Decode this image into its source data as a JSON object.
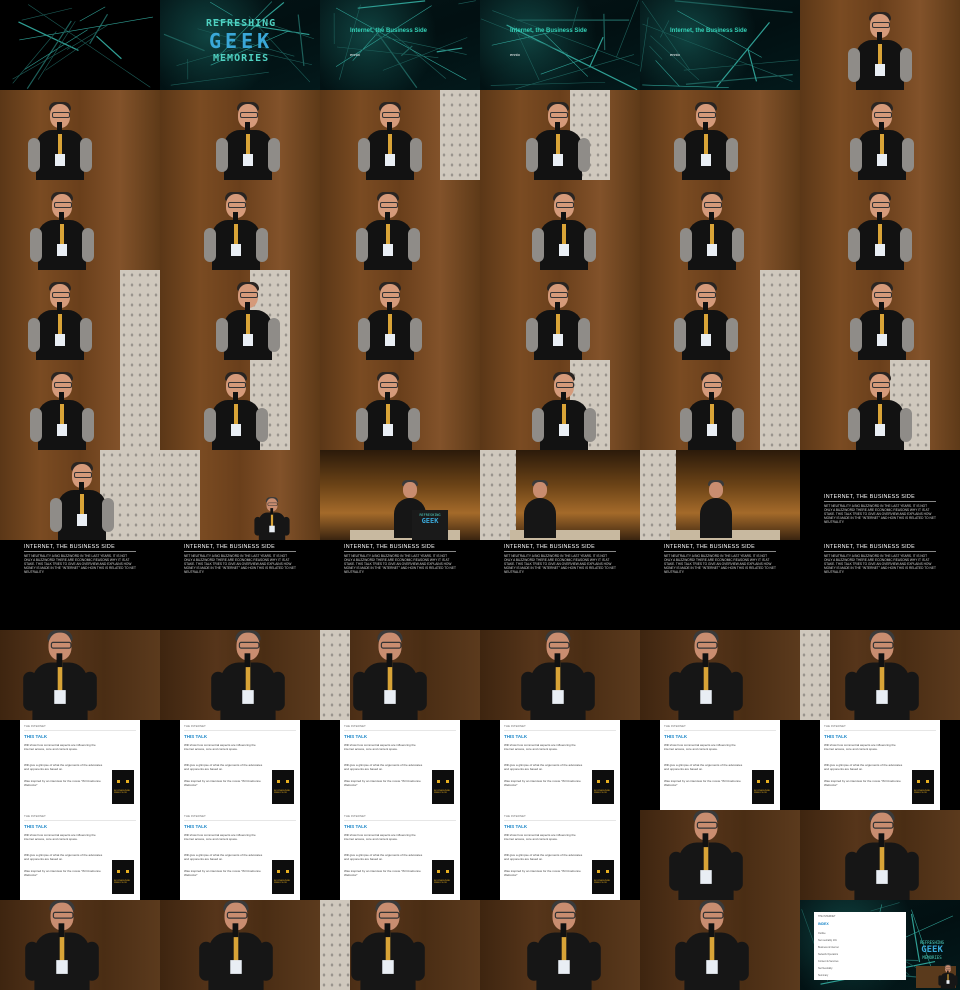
{
  "logo": {
    "line1": "REFRESHING",
    "line2": "GEEK",
    "line3": "MEMORIES"
  },
  "title_card": {
    "title": "Internet, the Business Side",
    "author": "ennio"
  },
  "abstract_slide": {
    "title": "INTERNET, THE BUSINESS SIDE",
    "body": "NET NEUTRALITY A BIG BUZZWORD IN THE LAST YEARS. IT IS NOT ONLY A BUZZWORD! THERE ARE ECONOMIC REASONS WHY IT IS AT STAKE. THIS TALK TRIES TO GIVE AN OVERVIEW AND EXPLAINS HOW MONEY IS MADE IN THE \"INTERNET\" AND HOW THIS IS RELATED TO NET NEUTRALITY."
  },
  "article_slide": {
    "breadcrumb": "THE INTERNET",
    "heading": "THIS TALK",
    "para1": "Will show how commercial aspects are influencing the internet access, core and content space.",
    "para2": "Will give a glimpse of what the arguments of the advocates and opponents are based on.",
    "para3": "Was inspired by an interview for the movie \"IM Cinebunne Webcolor\"",
    "book_title": "IM CINEBUNNE WEBCOLOR"
  },
  "outline_slide": {
    "breadcrumb": "THE INTERNET",
    "title": "INDEX",
    "items": [
      "Outline",
      "Net neutrality 101",
      "Business & Internet",
      "Network Operators",
      "Content & Services",
      "Net Neutrality",
      "Summary"
    ]
  },
  "colors": {
    "teal": "#34d2b8",
    "blue": "#1a86c8",
    "wood": "#7a4b22",
    "wall": "#cfc8bd"
  }
}
